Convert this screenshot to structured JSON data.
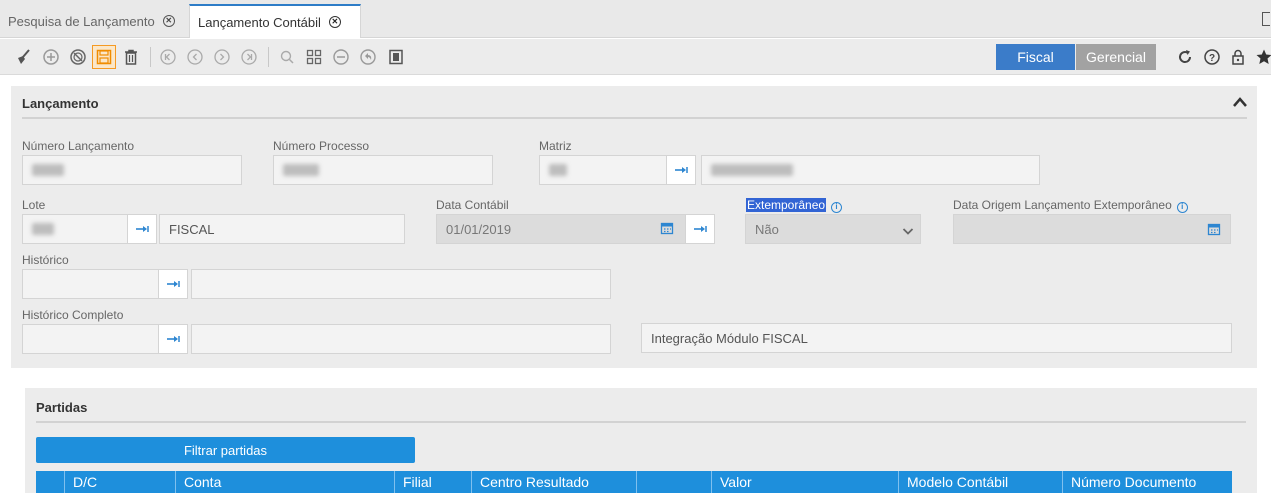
{
  "tabs": [
    {
      "label": "Pesquisa de Lançamento",
      "active": false
    },
    {
      "label": "Lançamento Contábil",
      "active": true
    }
  ],
  "toolbar": {
    "icons": [
      "broom-icon",
      "add-icon",
      "cancel-icon",
      "save-icon",
      "delete-icon",
      "first-icon",
      "previous-icon",
      "next-icon",
      "last-icon",
      "search-icon",
      "grid-icon",
      "remove-icon",
      "undo-icon",
      "copy-icon"
    ],
    "mode_fiscal": "Fiscal",
    "mode_gerencial": "Gerencial",
    "right_icons": [
      "refresh-icon",
      "help-icon",
      "lock-icon",
      "star-icon"
    ],
    "accent": "#3b7cc9",
    "save_highlight": "#f59a23"
  },
  "lancamento": {
    "title": "Lançamento",
    "numero_lancamento": {
      "label": "Número Lançamento"
    },
    "numero_processo": {
      "label": "Número Processo"
    },
    "matriz": {
      "label": "Matriz"
    },
    "lote": {
      "label": "Lote",
      "description": "FISCAL"
    },
    "data_contabil": {
      "label": "Data Contábil",
      "value": "01/01/2019"
    },
    "extemporaneo": {
      "label": "Extemporâneo",
      "value": "Não"
    },
    "data_origem": {
      "label": "Data Origem Lançamento Extemporâneo"
    },
    "historico": {
      "label": "Histórico"
    },
    "historico_completo": {
      "label": "Histórico Completo",
      "note": "Integração Módulo FISCAL"
    }
  },
  "partidas": {
    "title": "Partidas",
    "filter_button": "Filtrar partidas",
    "columns": [
      "D/C",
      "Conta",
      "Filial",
      "Centro Resultado",
      "",
      "Valor",
      "Modelo Contábil",
      "Número Documento"
    ],
    "header_color": "#1e8fdc"
  }
}
